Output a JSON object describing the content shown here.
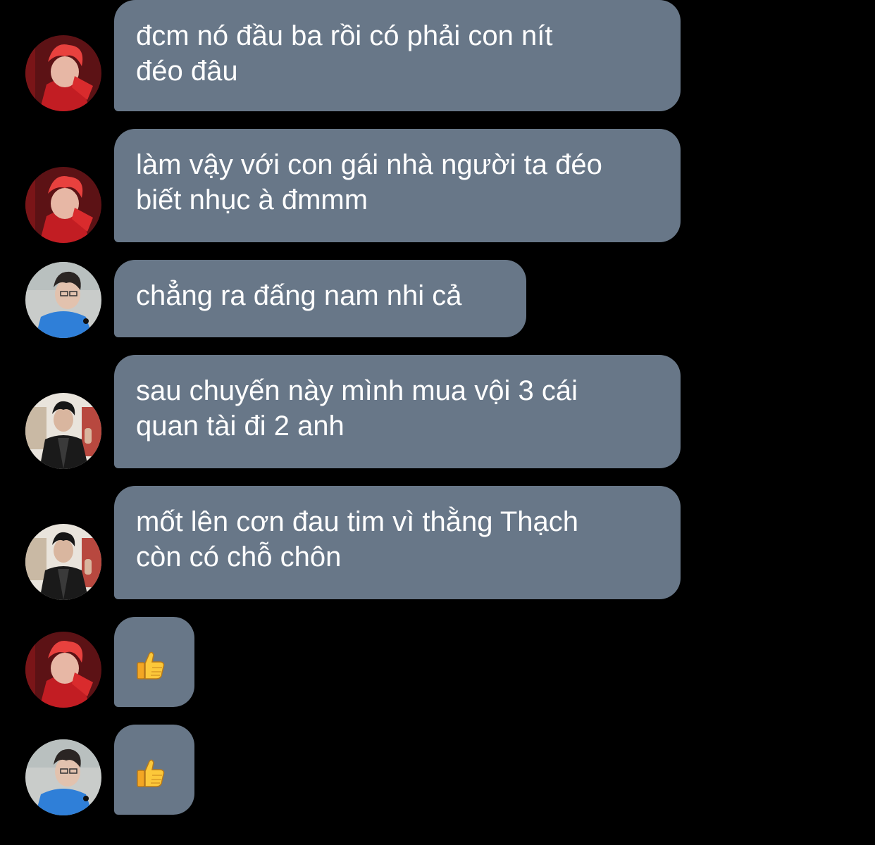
{
  "messages": [
    {
      "sender_avatar": "red-hair-avatar",
      "lines": [
        "đcm nó đầu ba rồi có phải con nít",
        "đéo đâu"
      ]
    },
    {
      "sender_avatar": "red-hair-avatar",
      "lines": [
        "làm vậy với con gái nhà người ta đéo",
        "biết nhục à đmmm"
      ]
    },
    {
      "sender_avatar": "blue-shirt-avatar",
      "lines": [
        "chẳng ra đấng nam nhi cả"
      ]
    },
    {
      "sender_avatar": "leather-jacket-avatar",
      "lines": [
        "sau chuyến này mình mua vội 3 cái",
        "quan tài đi 2 anh"
      ]
    },
    {
      "sender_avatar": "leather-jacket-avatar",
      "lines": [
        "mốt lên cơn đau tim vì thằng Thạch",
        "còn có chỗ chôn"
      ]
    },
    {
      "sender_avatar": "red-hair-avatar",
      "emoji": "thumbs-up-icon"
    },
    {
      "sender_avatar": "blue-shirt-avatar",
      "emoji": "thumbs-up-icon"
    }
  ],
  "colors": {
    "background": "#000000",
    "bubble": "#687788",
    "text": "#ffffff"
  }
}
